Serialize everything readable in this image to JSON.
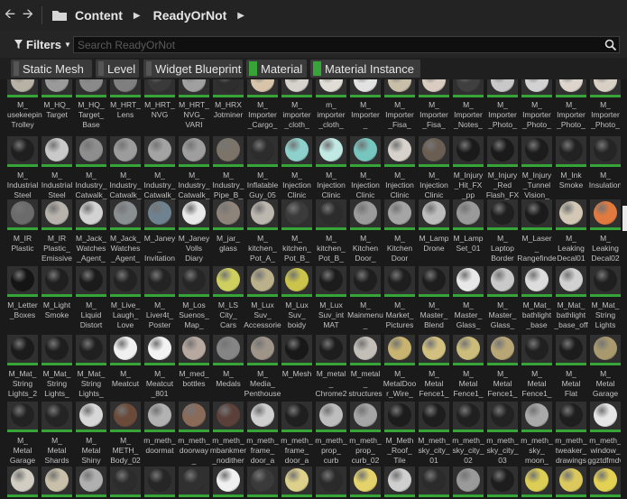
{
  "breadcrumb": {
    "root": "Content",
    "folder": "ReadyOrNot"
  },
  "filters": {
    "label": "Filters"
  },
  "search": {
    "placeholder": "Search ReadyOrNot"
  },
  "chips": [
    {
      "label": "Static Mesh",
      "active": false
    },
    {
      "label": "Level",
      "active": false
    },
    {
      "label": "Widget Blueprint",
      "active": false
    },
    {
      "label": "Material",
      "active": true
    },
    {
      "label": "Material Instance",
      "active": true
    }
  ],
  "rows": [
    [
      "M_\nousekeepin\nTrolley",
      "M_HQ_\nTarget",
      "M_HQ_\nTarget_\nBase",
      "M_HRT_\nLens",
      "M_HRT_\nNVG",
      "M_HRT_\nNVG_\nVARI",
      "M_HRX\nJotminer",
      "M_\nImporter\n_Cargo_",
      "M_\nimporter\n_cloth_",
      "m_\nimporter\n_cloth_",
      "M_\nImporter\n_",
      "M_\nImporter\n_Fisa_",
      "M_\nImporter\n_Fisa_",
      "M_\nImporter\n_Notes_",
      "M_\nImporter\n_Photo_",
      "M_\nImporter\n_Photo_",
      "M_\nImporter\n_Photo_",
      "M_\nImporter\n_Photo_"
    ],
    [
      "M_\nIndustrial\nSteel",
      "M_\nIndustrial\nSteel",
      "M_\nIndustry_\nCatwalk_",
      "M_\nIndustry_\nCatwalk_",
      "M_\nIndustry_\nCatwalk_",
      "M_\nIndustry_\nCatwalk_",
      "M_\nIndustry_\nPipe_B_",
      "M_\nInflatable\nGuy_05",
      "M_\nInjection\nClinic",
      "M_\nInjection\nClinic",
      "M_\nInjection\nClinic",
      "M_\nInjection\nClinic",
      "M_\nInjection\nClinic",
      "M_Injury\n_Hit_FX\n_pp",
      "M_Injury\n_Red\nFlash_FX",
      "M_Injury\n_Tunnel\nVision_",
      "M_Ink\nSmoke",
      "M_\nInsulation"
    ],
    [
      "M_IR\nPlastic",
      "M_IR\nPlastic_\nEmissive",
      "M_Jack_\nWatches\n_Agent_",
      "M_Jack_\nWatches\n_Agent_",
      "M_Janey\n_\nInvitation",
      "M_Janey\nVolls\nDiary",
      "M_jar_\nglass",
      "M_\nkitchen_\nPot_A_",
      "M_\nkitchen_\nPot_B_",
      "M_\nkitchen_\nPot_B_",
      "M_\nKitchen\nDoor_",
      "M_\nKitchen\nDoor",
      "M_Lamp\nDrone",
      "M_Lamp\nSet_01",
      "M_\nLaptop\nBorder",
      "M_Laser\n_\nRangefinde",
      "M_\nLeaking\nDecal01",
      "M_\nLeaking\nDecal02"
    ],
    [
      "M_Letter\n_Boxes",
      "M_Light\nSmoke",
      "M_\nLiquid\nDistort",
      "M_Live_\nLaugh_\nLove",
      "M_\nLiver4t_\nPoster",
      "M_Los\nSuenos_\nMap_",
      "M_LS\nCity_\nCars",
      "M_Lux\nSuv_\nAccessorie",
      "M_Lux\nSuv_\nboidy",
      "M_Lux\nSuv_int\nMAT",
      "M_\nMainmenu\n_",
      "M_\nMarket_\nPictures",
      "M_\nMaster_\nBlend",
      "M_\nMaster_\nGlass_",
      "M_\nMaster_\nGlass_",
      "M_Mat_\nbathlight\n_base",
      "M_Mat_\nbathlight\n_base_off",
      "M_Mat_\nString\nLights"
    ],
    [
      "M_Mat_\nString\nLights_2",
      "M_Mat_\nString\nLights_",
      "M_Mat_\nString\nLights_",
      "M_\nMeatcut",
      "M_\nMeatcut\n_801",
      "M_med_\nbottles",
      "M_\nMedals",
      "M_\nMedia_\nPenthouse",
      "M_Mesh",
      "M_metal\n_\nChrome2",
      "M_metal\n_\nstructures",
      "M_\nMetalDoo\nr_Wire_",
      "M_\nMetal\nFence1_",
      "M_\nMetal\nFence1_",
      "M_\nMetal\nFence1_",
      "M_\nMetal\nFence1_",
      "M_\nMetal\nFlat",
      "M_\nMetal\nGarage"
    ],
    [
      "M_\nMetal\nGarage\n_",
      "M_\nMetal\nShards",
      "M_\nMetal\nShiny",
      "M_\nMETH_\nBody_02",
      "m_meth_\ndoormat",
      "m_meth_\ndoorway\n_",
      "m_meth_\nmbankmer\n_nodither",
      "m_meth_\nframe_\ndoor_a",
      "m_meth_\nframe_\ndoor_a",
      "m_meth_\nprop_\ncurb",
      "m_meth_\nprop_\ncurb_02",
      "M_Meth\n_Roof_\nTile",
      "M_meth_\nsky_city_\n01",
      "m_meth_\nsky_city_\n02",
      "m_meth_\nsky_city_\n03",
      "m_meth_\nsky_\nmoon_",
      "m_meth_\ntweaker_\ndrawings",
      "m_meth_\nwindow_\nggztdfmdv"
    ],
    [
      "",
      "",
      "",
      "",
      "",
      "",
      "",
      "",
      "",
      "",
      "",
      "",
      "",
      "",
      "",
      "",
      "",
      ""
    ]
  ],
  "swatches": [
    [
      "#b8b2a6",
      "#9a9a9a",
      "#8a8a8a",
      "#7f7f7f",
      "#3a3a3a",
      "#a0a0a0",
      "#2e2e2e",
      "#d7c4a9",
      "#d6d2cc",
      "#e0dcd6",
      "#e2e2e2",
      "#c9bfa8",
      "#d9ccc0",
      "#3f3f3f",
      "#c8c8c8",
      "#d2d2d2",
      "#ddd5cc",
      "#d8d0c5"
    ],
    [
      "#1f1f1f",
      "#c9c9c9",
      "#8e8e8e",
      "#9c9c9c",
      "#a3a3a3",
      "#9e9e9e",
      "#7c7468",
      "#2c2c2c",
      "#8ed1cc",
      "#c0e9e4",
      "#77c5bf",
      "#d6d1cb",
      "#6a5e52",
      "#1a1a1a",
      "#1a1a1a",
      "#1c1c1c",
      "#222222",
      "#252525"
    ],
    [
      "#6b6b6b",
      "#b7b2ab",
      "#d2d2d2",
      "#8a8f92",
      "#6f8290",
      "#e9e9e9",
      "#8e847a",
      "#bcb7ae",
      "#3b3b3b",
      "#2c2c2c",
      "#9b9b9b",
      "#a5a5a5",
      "#bdbdbd",
      "#9a9a9a",
      "#1f1f1f",
      "#1b1b1b",
      "#d2c8b5",
      "#e27a3f"
    ],
    [
      "#141414",
      "#1f1f1f",
      "#1b1b1b",
      "#222222",
      "#232323",
      "#262626",
      "#cfcf60",
      "#bab08a",
      "#cac34c",
      "#1c1c1c",
      "#1e1e1e",
      "#1e1e1e",
      "#1d1d1d",
      "#e8e8e8",
      "#c9c9c9",
      "#dcdcdc",
      "#d1d1d1",
      "#1f1f1f"
    ],
    [
      "#1b1b1b",
      "#1e1e1e",
      "#202020",
      "#f0f0f0",
      "#f2f2f2",
      "#b8a9a0",
      "#858585",
      "#9e9488",
      "#181818",
      "#1d1d1d",
      "#c3bfb8",
      "#c8b370",
      "#d1c080",
      "#cbbc7b",
      "#b8a676",
      "#202020",
      "#1c1c1c",
      "#a89a6e"
    ],
    [
      "#222222",
      "#242424",
      "#d7d7d7",
      "#6b4a3a",
      "#b2b2b2",
      "#8a6a58",
      "#5a4038",
      "#cfcfcf",
      "#1f1f1f",
      "#bdbdbd",
      "#a5a5a5",
      "#1c1c1c",
      "#1d1d1d",
      "#202020",
      "#222222",
      "#a9a9a9",
      "#1e1e1e",
      "#e6e6e6"
    ],
    [
      "#d2cdc2",
      "#c9c0aa",
      "#b0b0b0",
      "#2c2c2c",
      "#262626",
      "#303030",
      "#f0f0f0",
      "#3a3a3a",
      "#ddd08b",
      "#2a2a2a",
      "#e4d36a",
      "#cfcfcf",
      "#2b2b2b",
      "#9a9a9a",
      "#1d1d1d",
      "#dccd55",
      "#dbc95e",
      "#e3d153"
    ]
  ],
  "icons": {
    "back": "arrow-left-icon",
    "forward": "arrow-right-icon",
    "folder": "folder-icon",
    "filter": "filter-icon",
    "search": "search-icon"
  },
  "colors": {
    "accent_green": "#36a437"
  }
}
